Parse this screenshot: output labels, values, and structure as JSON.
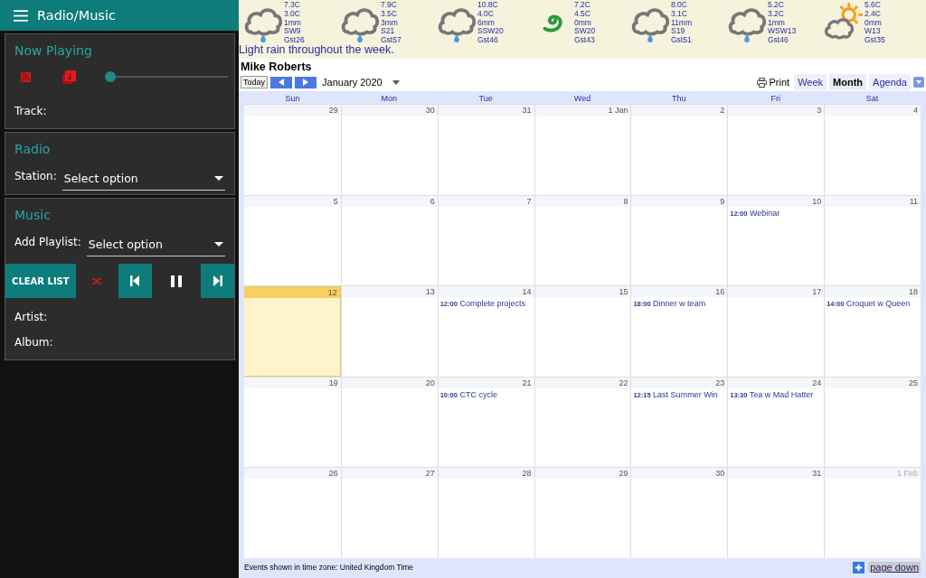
{
  "app_bar": {
    "title": "Radio/Music"
  },
  "now_playing": {
    "title": "Now Playing",
    "volume": {
      "level": 0.0
    },
    "track_label": "Track:"
  },
  "radio": {
    "title": "Radio",
    "station_label": "Station:",
    "station_placeholder": "Select option"
  },
  "music": {
    "title": "Music",
    "playlist_label": "Add Playlist:",
    "playlist_placeholder": "Select option",
    "clear_button": "CLEAR LIST",
    "artist_label": "Artist:",
    "album_label": "Album:"
  },
  "weather": [
    {
      "kind": "rain",
      "lines": [
        "7.3C",
        "3.0C",
        "1mm",
        "SW9",
        "Gst26"
      ]
    },
    {
      "kind": "rain",
      "lines": [
        "7.9C",
        "3.5C",
        "3mm",
        "S21",
        "Gst57"
      ]
    },
    {
      "kind": "rain",
      "lines": [
        "10.8C",
        "4.0C",
        "6mm",
        "SSW20",
        "Gst46"
      ]
    },
    {
      "kind": "swirl",
      "lines": [
        "7.2C",
        "4.5C",
        "0mm",
        "SW20",
        "Gst43"
      ]
    },
    {
      "kind": "rain",
      "lines": [
        "8.0C",
        "3.1C",
        "11mm",
        "S19",
        "Gst51"
      ]
    },
    {
      "kind": "rain",
      "lines": [
        "5.2C",
        "3.2C",
        "1mm",
        "WSW13",
        "Gst46"
      ]
    },
    {
      "kind": "sun-cloud",
      "lines": [
        "5.6C",
        "2.4C",
        "0mm",
        "W13",
        "Gst35"
      ]
    }
  ],
  "weather_summary": "Light rain throughout the week.",
  "calendar": {
    "owner": "Mike Roberts",
    "today_button": "Today",
    "period": "January 2020",
    "print": "Print",
    "views": [
      {
        "label": "Week",
        "selected": false
      },
      {
        "label": "Month",
        "selected": true
      },
      {
        "label": "Agenda",
        "selected": false
      }
    ],
    "weekdays": [
      "Sun",
      "Mon",
      "Tue",
      "Wed",
      "Thu",
      "Fri",
      "Sat"
    ],
    "weeks": [
      [
        {
          "day": "29",
          "muted": false,
          "today": false
        },
        {
          "day": "30",
          "muted": false,
          "today": false
        },
        {
          "day": "31",
          "muted": false,
          "today": false
        },
        {
          "day": "1 Jan",
          "muted": false,
          "today": false
        },
        {
          "day": "2",
          "muted": false,
          "today": false
        },
        {
          "day": "3",
          "muted": false,
          "today": false
        },
        {
          "day": "4",
          "muted": false,
          "today": false
        }
      ],
      [
        {
          "day": "5",
          "muted": false,
          "today": false
        },
        {
          "day": "6",
          "muted": false,
          "today": false
        },
        {
          "day": "7",
          "muted": false,
          "today": false
        },
        {
          "day": "8",
          "muted": false,
          "today": false
        },
        {
          "day": "9",
          "muted": false,
          "today": false
        },
        {
          "day": "10",
          "muted": false,
          "today": false,
          "events": [
            {
              "time": "12:00",
              "title": "Webinar"
            }
          ]
        },
        {
          "day": "11",
          "muted": false,
          "today": false
        }
      ],
      [
        {
          "day": "12",
          "muted": false,
          "today": true
        },
        {
          "day": "13",
          "muted": false,
          "today": false
        },
        {
          "day": "14",
          "muted": false,
          "today": false,
          "events": [
            {
              "time": "12:00",
              "title": "Complete projects"
            }
          ]
        },
        {
          "day": "15",
          "muted": false,
          "today": false
        },
        {
          "day": "16",
          "muted": false,
          "today": false,
          "events": [
            {
              "time": "18:00",
              "title": "Dinner w team"
            }
          ]
        },
        {
          "day": "17",
          "muted": false,
          "today": false
        },
        {
          "day": "18",
          "muted": false,
          "today": false,
          "events": [
            {
              "time": "14:00",
              "title": "Croquet w Queen"
            }
          ]
        }
      ],
      [
        {
          "day": "19",
          "muted": false,
          "today": false
        },
        {
          "day": "20",
          "muted": false,
          "today": false
        },
        {
          "day": "21",
          "muted": false,
          "today": false,
          "events": [
            {
              "time": "10:00",
              "title": "CTC cycle"
            }
          ]
        },
        {
          "day": "22",
          "muted": false,
          "today": false
        },
        {
          "day": "23",
          "muted": false,
          "today": false,
          "events": [
            {
              "time": "12:15",
              "title": "Last Summer Win"
            }
          ]
        },
        {
          "day": "24",
          "muted": false,
          "today": false,
          "events": [
            {
              "time": "13:30",
              "title": "Tea w Mad Hatter"
            }
          ]
        },
        {
          "day": "25",
          "muted": false,
          "today": false
        }
      ],
      [
        {
          "day": "26",
          "muted": false,
          "today": false
        },
        {
          "day": "27",
          "muted": false,
          "today": false
        },
        {
          "day": "28",
          "muted": false,
          "today": false
        },
        {
          "day": "29",
          "muted": false,
          "today": false
        },
        {
          "day": "30",
          "muted": false,
          "today": false
        },
        {
          "day": "31",
          "muted": false,
          "today": false
        },
        {
          "day": "1 Feb",
          "muted": true,
          "today": false
        }
      ]
    ],
    "timezone_note": "Events shown in time zone: United Kingdom Time",
    "page_link": "page down"
  }
}
